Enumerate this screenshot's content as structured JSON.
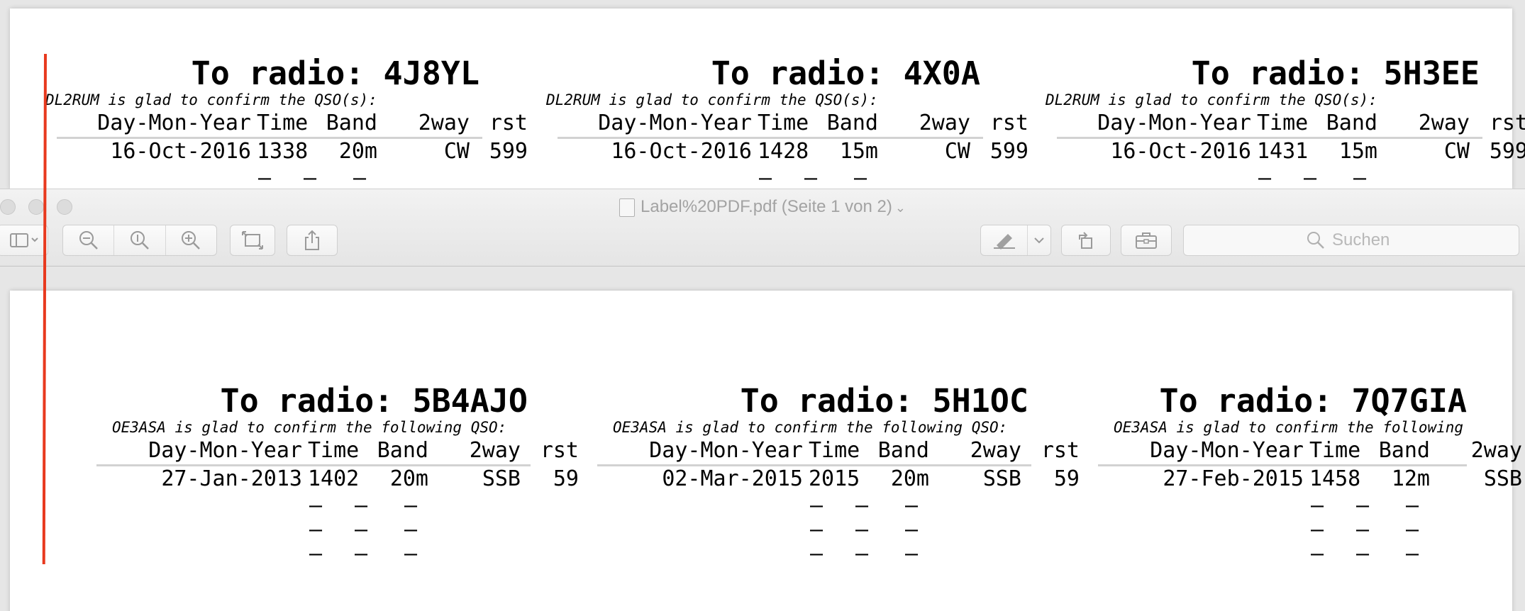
{
  "window": {
    "title": "Label%20PDF.pdf (Seite 1 von 2)",
    "search_placeholder": "Suchen"
  },
  "page1_labels": [
    {
      "title": "To radio: 4J8YL",
      "confirm": "DL2RUM is glad to confirm the QSO(s):",
      "headers": [
        "Day-Mon-Year",
        "Time",
        "Band",
        "2way",
        "rst"
      ],
      "row": {
        "date": "16-Oct-2016",
        "time": "1338",
        "band": "20m",
        "mode": "CW",
        "rst": "599"
      },
      "dash_rows": [
        [
          "–",
          "–",
          "–"
        ]
      ]
    },
    {
      "title": "To radio: 4X0A",
      "confirm": "DL2RUM is glad to confirm the QSO(s):",
      "headers": [
        "Day-Mon-Year",
        "Time",
        "Band",
        "2way",
        "rst"
      ],
      "row": {
        "date": "16-Oct-2016",
        "time": "1428",
        "band": "15m",
        "mode": "CW",
        "rst": "599"
      },
      "dash_rows": [
        [
          "–",
          "–",
          "–"
        ]
      ]
    },
    {
      "title": "To radio: 5H3EE",
      "confirm": "DL2RUM is glad to confirm the QSO(s):",
      "headers": [
        "Day-Mon-Year",
        "Time",
        "Band",
        "2way",
        "rst"
      ],
      "row": {
        "date": "16-Oct-2016",
        "time": "1431",
        "band": "15m",
        "mode": "CW",
        "rst": "599"
      },
      "dash_rows": [
        [
          "–",
          "–",
          "–"
        ]
      ]
    }
  ],
  "page2_labels": [
    {
      "title": "To radio: 5B4AJO",
      "confirm": "OE3ASA is glad to confirm the following QSO:",
      "headers": [
        "Day-Mon-Year",
        "Time",
        "Band",
        "2way",
        "rst"
      ],
      "row": {
        "date": "27-Jan-2013",
        "time": "1402",
        "band": "20m",
        "mode": "SSB",
        "rst": "59"
      },
      "dash_rows": [
        [
          "–",
          "–",
          "–"
        ],
        [
          "–",
          "–",
          "–"
        ],
        [
          "–",
          "–",
          "–"
        ]
      ]
    },
    {
      "title": "To radio: 5H1OC",
      "confirm": "OE3ASA is glad to confirm the following QSO:",
      "headers": [
        "Day-Mon-Year",
        "Time",
        "Band",
        "2way",
        "rst"
      ],
      "row": {
        "date": "02-Mar-2015",
        "time": "2015",
        "band": "20m",
        "mode": "SSB",
        "rst": "59"
      },
      "dash_rows": [
        [
          "–",
          "–",
          "–"
        ],
        [
          "–",
          "–",
          "–"
        ],
        [
          "–",
          "–",
          "–"
        ]
      ]
    },
    {
      "title": "To radio: 7Q7GIA",
      "confirm": "OE3ASA is glad to confirm the following",
      "headers": [
        "Day-Mon-Year",
        "Time",
        "Band",
        "2way",
        ""
      ],
      "row": {
        "date": "27-Feb-2015",
        "time": "1458",
        "band": "12m",
        "mode": "SSB",
        "rst": ""
      },
      "dash_rows": [
        [
          "–",
          "–",
          "–"
        ],
        [
          "–",
          "–",
          "–"
        ],
        [
          "–",
          "–",
          "–"
        ]
      ]
    }
  ],
  "icons": [
    "sidebar-toggle-icon",
    "zoom-out-icon",
    "actual-size-icon",
    "zoom-in-icon",
    "resize-icon",
    "share-icon",
    "markup-pen-icon",
    "rotate-icon",
    "toolbox-icon",
    "search-icon"
  ],
  "colors": {
    "annotation_line": "#e8391e",
    "toolbar_bg": "#ececec",
    "page_bg": "#ffffff",
    "desk_bg": "#e6e6e6"
  }
}
